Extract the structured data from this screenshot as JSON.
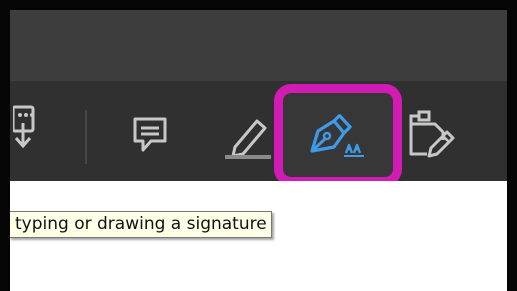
{
  "toolbar": {
    "tools": [
      {
        "name": "export",
        "icon": "export-pdf-icon"
      },
      {
        "name": "comment",
        "icon": "comment-icon"
      },
      {
        "name": "highlight",
        "icon": "highlight-pen-icon"
      },
      {
        "name": "fill-and-sign",
        "icon": "signature-pen-icon",
        "highlighted": true
      },
      {
        "name": "prepare-form",
        "icon": "form-edit-icon"
      }
    ]
  },
  "tooltip": {
    "text": "typing or drawing a signature"
  },
  "colors": {
    "window_border": "#050505",
    "titlebar_bg": "#3d3d3d",
    "toolbar_bg": "#303030",
    "icon_gray": "#c8c8c8",
    "icon_active_blue": "#3d9be9",
    "highlight_magenta": "#d21ab4",
    "tooltip_bg": "#ffffe8",
    "content_bg": "#ffffff"
  }
}
